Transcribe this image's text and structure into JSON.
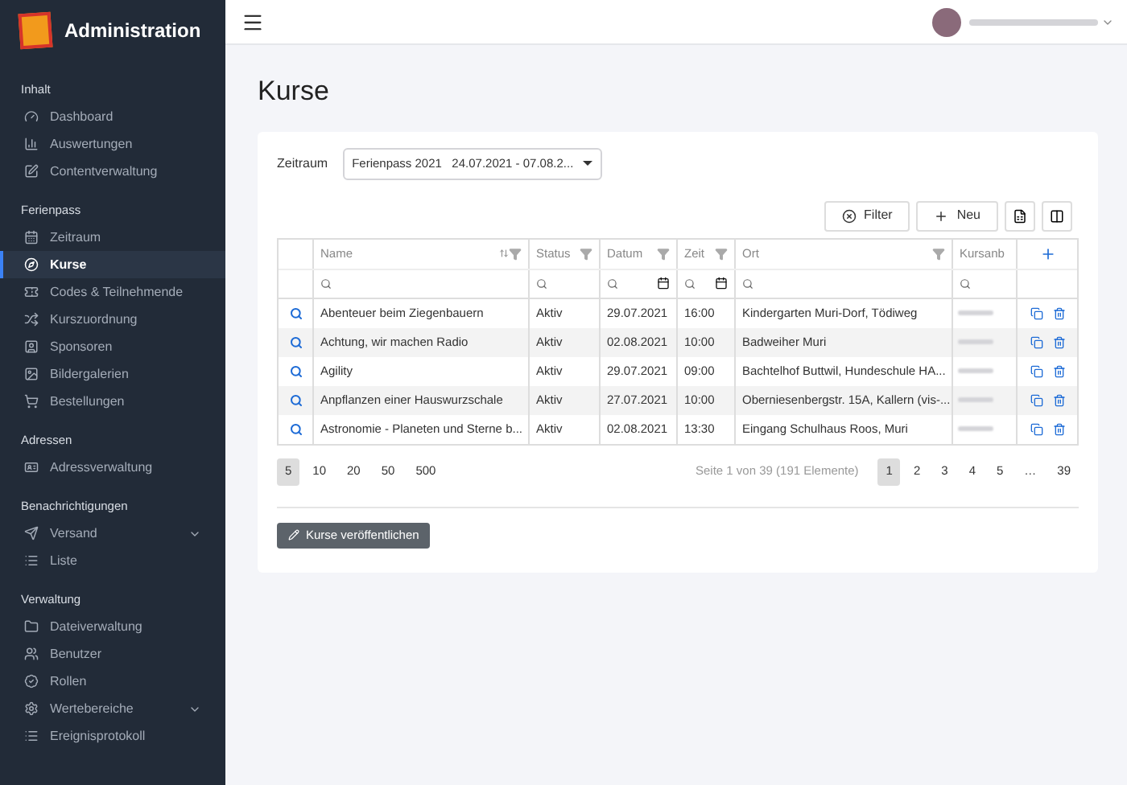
{
  "app": {
    "title": "Administration"
  },
  "sidebar": {
    "sections": [
      {
        "title": "Inhalt",
        "items": [
          {
            "label": "Dashboard",
            "selected": false,
            "expandable": false
          },
          {
            "label": "Auswertungen",
            "selected": false,
            "expandable": false
          },
          {
            "label": "Contentverwaltung",
            "selected": false,
            "expandable": false
          }
        ]
      },
      {
        "title": "Ferienpass",
        "items": [
          {
            "label": "Zeitraum",
            "selected": false,
            "expandable": false
          },
          {
            "label": "Kurse",
            "selected": true,
            "expandable": false
          },
          {
            "label": "Codes & Teilnehmende",
            "selected": false,
            "expandable": false
          },
          {
            "label": "Kurszuordnung",
            "selected": false,
            "expandable": false
          },
          {
            "label": "Sponsoren",
            "selected": false,
            "expandable": false
          },
          {
            "label": "Bildergalerien",
            "selected": false,
            "expandable": false
          },
          {
            "label": "Bestellungen",
            "selected": false,
            "expandable": false
          }
        ]
      },
      {
        "title": "Adressen",
        "items": [
          {
            "label": "Adressverwaltung",
            "selected": false,
            "expandable": false
          }
        ]
      },
      {
        "title": "Benachrichtigungen",
        "items": [
          {
            "label": "Versand",
            "selected": false,
            "expandable": true
          },
          {
            "label": "Liste",
            "selected": false,
            "expandable": false
          }
        ]
      },
      {
        "title": "Verwaltung",
        "items": [
          {
            "label": "Dateiverwaltung",
            "selected": false,
            "expandable": false
          },
          {
            "label": "Benutzer",
            "selected": false,
            "expandable": false
          },
          {
            "label": "Rollen",
            "selected": false,
            "expandable": false
          },
          {
            "label": "Wertebereiche",
            "selected": false,
            "expandable": true
          },
          {
            "label": "Ereignisprotokoll",
            "selected": false,
            "expandable": false
          }
        ]
      }
    ]
  },
  "page": {
    "title": "Kurse"
  },
  "period": {
    "label": "Zeitraum",
    "value": "Ferienpass 2021   24.07.2021 - 07.08.2..."
  },
  "toolbar": {
    "filter": "Filter",
    "new": "Neu"
  },
  "table": {
    "columns": [
      {
        "label": "Name",
        "sortable": true,
        "kind": "text"
      },
      {
        "label": "Status",
        "sortable": false,
        "kind": "text"
      },
      {
        "label": "Datum",
        "sortable": false,
        "kind": "date"
      },
      {
        "label": "Zeit",
        "sortable": false,
        "kind": "date"
      },
      {
        "label": "Ort",
        "sortable": false,
        "kind": "text"
      },
      {
        "label": "Kursanb",
        "sortable": false,
        "kind": "text"
      }
    ],
    "rows": [
      {
        "name": "Abenteuer beim Ziegenbauern",
        "status": "Aktiv",
        "date": "29.07.2021",
        "time": "16:00",
        "place": "Kindergarten Muri-Dorf, Tödiweg"
      },
      {
        "name": "Achtung, wir machen Radio",
        "status": "Aktiv",
        "date": "02.08.2021",
        "time": "10:00",
        "place": "Badweiher Muri"
      },
      {
        "name": "Agility",
        "status": "Aktiv",
        "date": "29.07.2021",
        "time": "09:00",
        "place": "Bachtelhof Buttwil, Hundeschule HA..."
      },
      {
        "name": "Anpflanzen einer Hauswurzschale",
        "status": "Aktiv",
        "date": "27.07.2021",
        "time": "10:00",
        "place": "Oberniesenbergstr. 15A, Kallern (vis-..."
      },
      {
        "name": "Astronomie - Planeten und Sterne b...",
        "status": "Aktiv",
        "date": "02.08.2021",
        "time": "13:30",
        "place": "Eingang Schulhaus Roos, Muri"
      }
    ]
  },
  "pager": {
    "sizes": [
      {
        "label": "5",
        "selected": true
      },
      {
        "label": "10",
        "selected": false
      },
      {
        "label": "20",
        "selected": false
      },
      {
        "label": "50",
        "selected": false
      },
      {
        "label": "500",
        "selected": false
      }
    ],
    "info": "Seite 1 von 39 (191 Elemente)",
    "pages": [
      {
        "label": "1",
        "selected": true
      },
      {
        "label": "2",
        "selected": false
      },
      {
        "label": "3",
        "selected": false
      },
      {
        "label": "4",
        "selected": false
      },
      {
        "label": "5",
        "selected": false
      },
      {
        "label": "…",
        "selected": false
      },
      {
        "label": "39",
        "selected": false
      }
    ]
  },
  "publish": {
    "label": "Kurse veröffentlichen"
  }
}
